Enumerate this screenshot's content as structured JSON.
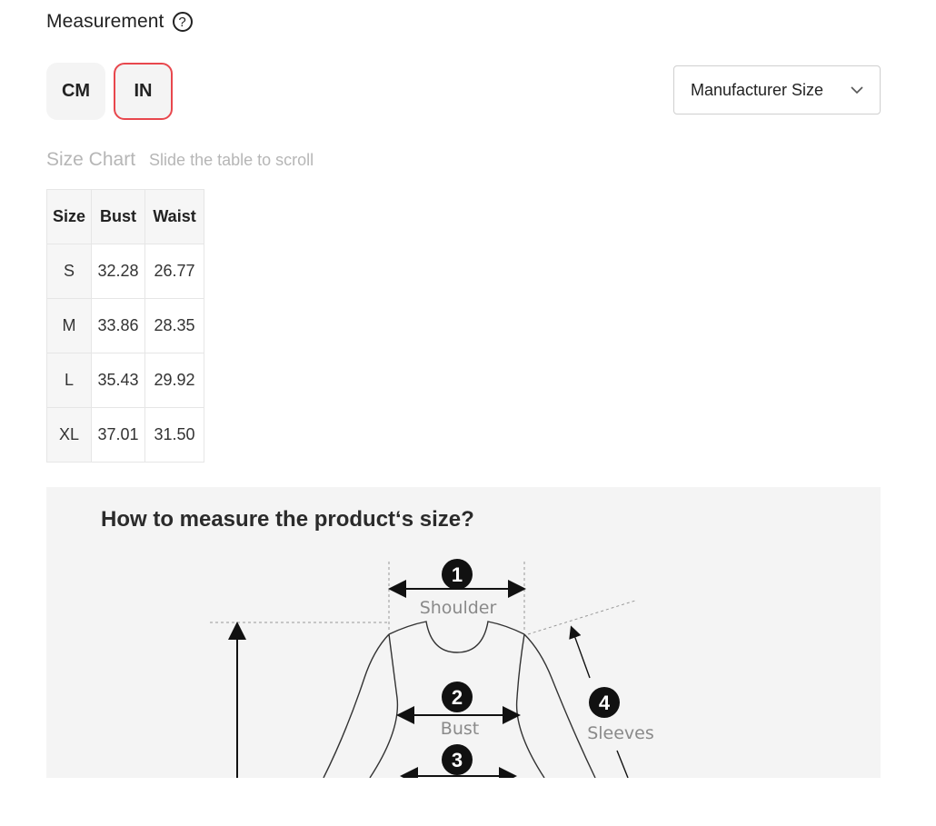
{
  "header": {
    "title": "Measurement",
    "help_glyph": "?"
  },
  "units": {
    "cm_label": "CM",
    "in_label": "IN",
    "selected": "IN"
  },
  "size_select": {
    "value": "Manufacturer Size"
  },
  "size_chart": {
    "title": "Size Chart",
    "hint": "Slide the table to scroll",
    "columns": [
      "Size",
      "Bust",
      "Waist"
    ],
    "rows": [
      [
        "S",
        "32.28",
        "26.77"
      ],
      [
        "M",
        "33.86",
        "28.35"
      ],
      [
        "L",
        "35.43",
        "29.92"
      ],
      [
        "XL",
        "37.01",
        "31.50"
      ]
    ]
  },
  "guide": {
    "heading": "How to measure the product‘s size?",
    "measurements": [
      {
        "num": "1",
        "label": "Shoulder"
      },
      {
        "num": "2",
        "label": "Bust"
      },
      {
        "num": "3",
        "label": ""
      },
      {
        "num": "4",
        "label": "Sleeves"
      }
    ]
  },
  "colors": {
    "accent": "#e8474d",
    "text": "#222222",
    "muted": "#b6b6b6",
    "panel": "#f4f4f4"
  }
}
